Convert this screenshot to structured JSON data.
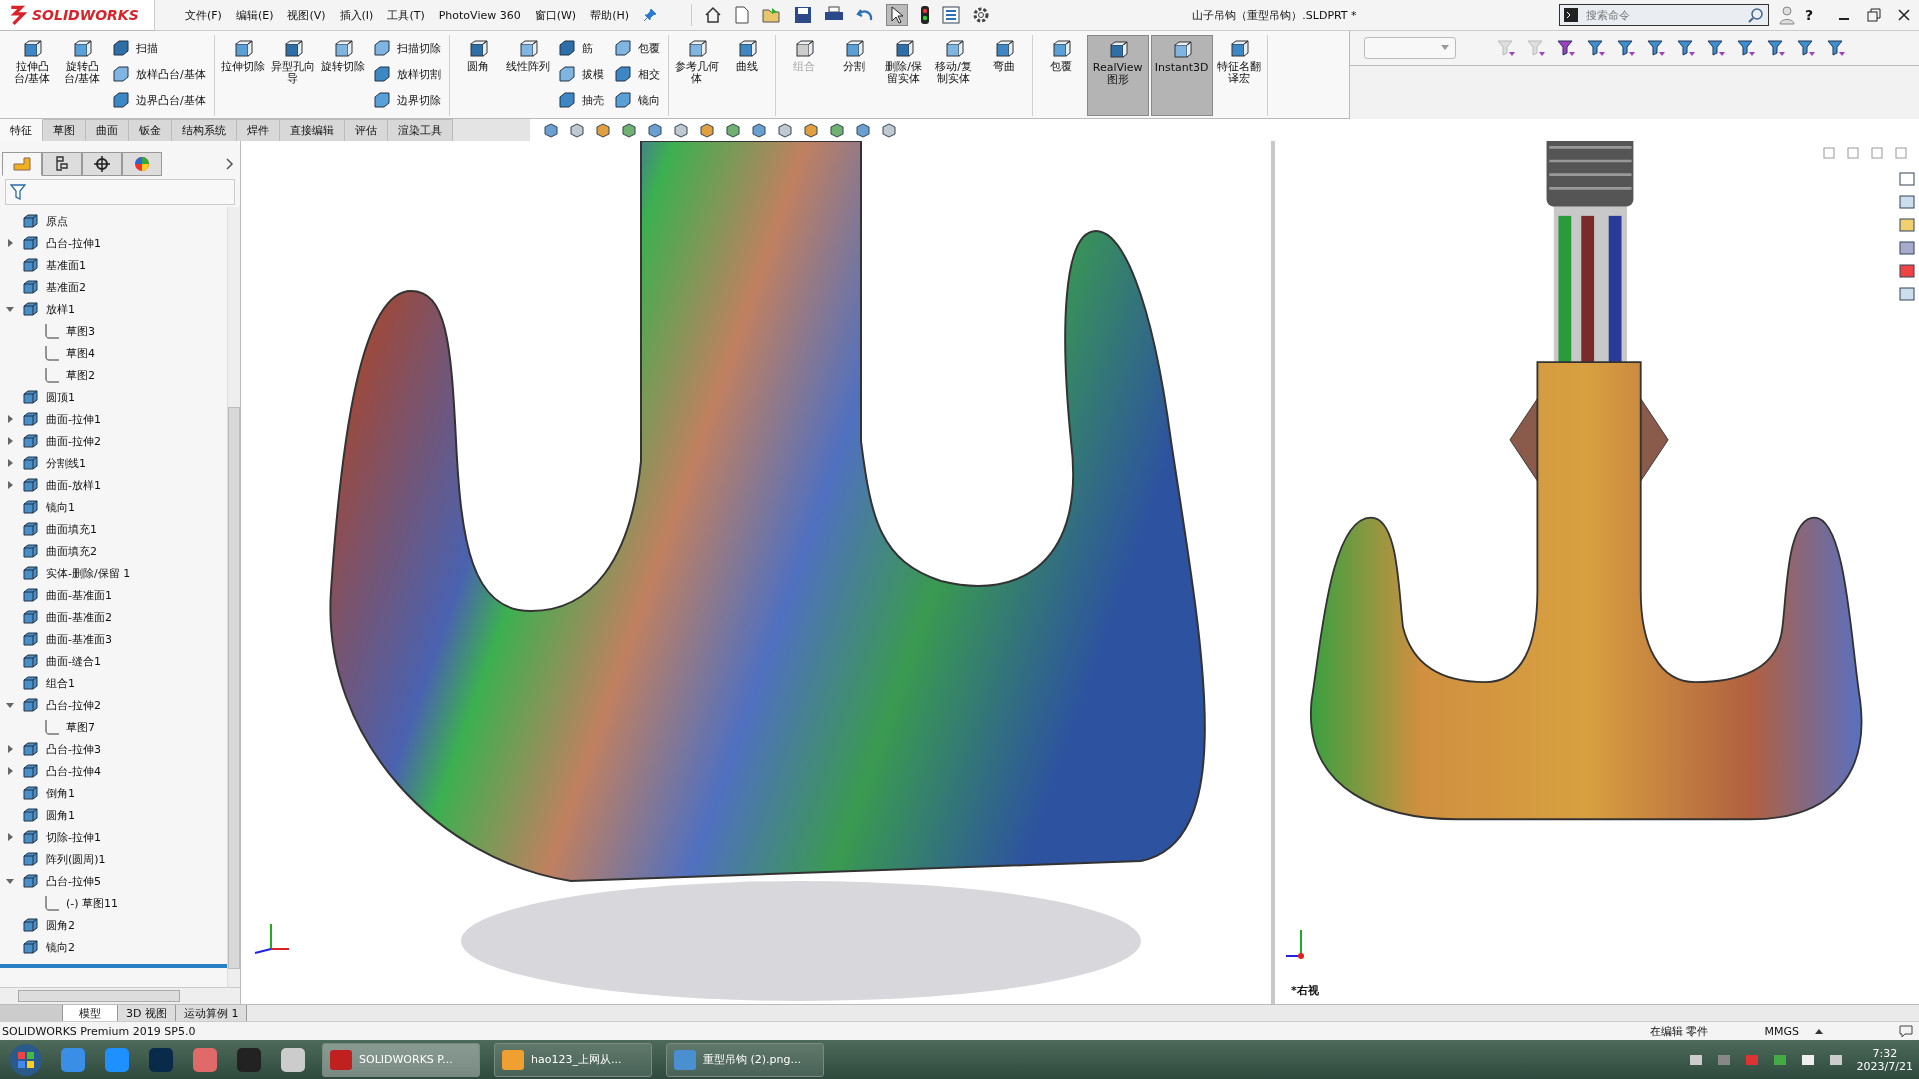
{
  "title_bar": {
    "logo": "SOLIDWORKS",
    "menus": [
      "文件(F)",
      "编辑(E)",
      "视图(V)",
      "插入(I)",
      "工具(T)",
      "PhotoView 360",
      "窗口(W)",
      "帮助(H)"
    ],
    "title": "山子吊钩（重型吊钩）.SLDPRT *",
    "search": {
      "placeholder": "搜索命令"
    },
    "help": "?"
  },
  "command_groups": [
    {
      "columns": [
        {
          "kind": "large",
          "tools": [
            {
              "label": "拉伸凸台/基体",
              "disabled": false,
              "pressed": false
            }
          ]
        },
        {
          "kind": "large",
          "tools": [
            {
              "label": "旋转凸台/基体",
              "disabled": false,
              "pressed": false
            }
          ]
        },
        {
          "kind": "small",
          "tools": [
            {
              "label": "扫描",
              "disabled": false,
              "pressed": false
            },
            {
              "label": "放样凸台/基体",
              "disabled": false,
              "pressed": false
            },
            {
              "label": "边界凸台/基体",
              "disabled": false,
              "pressed": false
            }
          ]
        }
      ]
    },
    {
      "columns": [
        {
          "kind": "large",
          "tools": [
            {
              "label": "拉伸切除",
              "disabled": false,
              "pressed": false
            }
          ]
        },
        {
          "kind": "large",
          "tools": [
            {
              "label": "异型孔向导",
              "disabled": false,
              "pressed": false
            }
          ]
        },
        {
          "kind": "large",
          "tools": [
            {
              "label": "旋转切除",
              "disabled": false,
              "pressed": false
            }
          ]
        },
        {
          "kind": "small",
          "tools": [
            {
              "label": "扫描切除",
              "disabled": false,
              "pressed": false
            },
            {
              "label": "放样切割",
              "disabled": false,
              "pressed": false
            },
            {
              "label": "边界切除",
              "disabled": false,
              "pressed": false
            }
          ]
        }
      ]
    },
    {
      "columns": [
        {
          "kind": "large",
          "tools": [
            {
              "label": "圆角",
              "disabled": false,
              "pressed": false
            }
          ]
        },
        {
          "kind": "large",
          "tools": [
            {
              "label": "线性阵列",
              "disabled": false,
              "pressed": false
            }
          ]
        },
        {
          "kind": "small",
          "tools": [
            {
              "label": "筋",
              "disabled": false,
              "pressed": false
            },
            {
              "label": "拔模",
              "disabled": false,
              "pressed": false
            },
            {
              "label": "抽壳",
              "disabled": false,
              "pressed": false
            }
          ]
        },
        {
          "kind": "small",
          "tools": [
            {
              "label": "包覆",
              "disabled": false,
              "pressed": false
            },
            {
              "label": "相交",
              "disabled": false,
              "pressed": false
            },
            {
              "label": "镜向",
              "disabled": false,
              "pressed": false
            }
          ]
        }
      ]
    },
    {
      "columns": [
        {
          "kind": "large",
          "tools": [
            {
              "label": "参考几何体",
              "disabled": false,
              "pressed": false
            }
          ]
        },
        {
          "kind": "large",
          "tools": [
            {
              "label": "曲线",
              "disabled": false,
              "pressed": false
            }
          ]
        }
      ]
    },
    {
      "columns": [
        {
          "kind": "large",
          "tools": [
            {
              "label": "组合",
              "disabled": true,
              "pressed": false
            }
          ]
        },
        {
          "kind": "large",
          "tools": [
            {
              "label": "分割",
              "disabled": false,
              "pressed": false
            }
          ]
        },
        {
          "kind": "large",
          "tools": [
            {
              "label": "删除/保留实体",
              "disabled": false,
              "pressed": false
            }
          ]
        },
        {
          "kind": "large",
          "tools": [
            {
              "label": "移动/复制实体",
              "disabled": false,
              "pressed": false
            }
          ]
        },
        {
          "kind": "large",
          "tools": [
            {
              "label": "弯曲",
              "disabled": false,
              "pressed": false
            }
          ]
        }
      ]
    },
    {
      "columns": [
        {
          "kind": "large",
          "tools": [
            {
              "label": "包覆",
              "disabled": false,
              "pressed": false
            }
          ]
        },
        {
          "kind": "large",
          "tools": [
            {
              "label": "RealView图形",
              "disabled": false,
              "pressed": true
            }
          ]
        },
        {
          "kind": "large",
          "tools": [
            {
              "label": "Instant3D",
              "disabled": false,
              "pressed": true
            }
          ]
        },
        {
          "kind": "large",
          "tools": [
            {
              "label": "特征名翻译宏",
              "disabled": false,
              "pressed": false
            }
          ]
        }
      ]
    }
  ],
  "tabs": [
    {
      "label": "特征",
      "selected": true
    },
    {
      "label": "草图",
      "selected": false
    },
    {
      "label": "曲面",
      "selected": false
    },
    {
      "label": "钣金",
      "selected": false
    },
    {
      "label": "结构系统",
      "selected": false
    },
    {
      "label": "焊件",
      "selected": false
    },
    {
      "label": "直接编辑",
      "selected": false
    },
    {
      "label": "评估",
      "selected": false
    },
    {
      "label": "渲染工具",
      "selected": false
    }
  ],
  "panel_tabs": [
    {
      "selected": true
    },
    {
      "selected": false
    },
    {
      "selected": false
    },
    {
      "selected": false
    }
  ],
  "feature_tree": [
    {
      "label": "原点"
    },
    {
      "label": "凸台-拉伸1",
      "expanded": false
    },
    {
      "label": "基准面1"
    },
    {
      "label": "基准面2"
    },
    {
      "label": "放样1",
      "expanded": true,
      "children": [
        {
          "label": "草图3"
        },
        {
          "label": "草图4"
        },
        {
          "label": "草图2"
        }
      ]
    },
    {
      "label": "圆顶1"
    },
    {
      "label": "曲面-拉伸1",
      "expanded": false
    },
    {
      "label": "曲面-拉伸2",
      "expanded": false
    },
    {
      "label": "分割线1",
      "expanded": false
    },
    {
      "label": "曲面-放样1",
      "expanded": false
    },
    {
      "label": "镜向1"
    },
    {
      "label": "曲面填充1"
    },
    {
      "label": "曲面填充2"
    },
    {
      "label": "实体-删除/保留 1"
    },
    {
      "label": "曲面-基准面1"
    },
    {
      "label": "曲面-基准面2"
    },
    {
      "label": "曲面-基准面3"
    },
    {
      "label": "曲面-缝合1"
    },
    {
      "label": "组合1"
    },
    {
      "label": "凸台-拉伸2",
      "expanded": true,
      "children": [
        {
          "label": "草图7"
        }
      ]
    },
    {
      "label": "凸台-拉伸3",
      "expanded": false
    },
    {
      "label": "凸台-拉伸4",
      "expanded": false
    },
    {
      "label": "倒角1"
    },
    {
      "label": "圆角1"
    },
    {
      "label": "切除-拉伸1",
      "expanded": false
    },
    {
      "label": "阵列(圆周)1"
    },
    {
      "label": "凸台-拉伸5",
      "expanded": true,
      "children": [
        {
          "label": "(-) 草图11"
        }
      ]
    },
    {
      "label": "圆角2"
    },
    {
      "label": "镜向2"
    }
  ],
  "viewport_label": "*右视",
  "bottom_tabs": [
    {
      "label": "模型",
      "selected": true
    },
    {
      "label": "3D 视图",
      "selected": false
    },
    {
      "label": "运动算例 1",
      "selected": false
    }
  ],
  "status_bar": {
    "product": "SOLIDWORKS Premium 2019 SP5.0",
    "mode": "在编辑 零件",
    "units": "MMGS"
  },
  "taskbar": {
    "apps": [
      {
        "label": "SOLIDWORKS P...",
        "selected": true
      },
      {
        "label": "hao123_上网从...",
        "selected": false
      },
      {
        "label": "重型吊钩 (2).png...",
        "selected": false
      }
    ],
    "time": "7:32",
    "date": "2023/7/21"
  }
}
